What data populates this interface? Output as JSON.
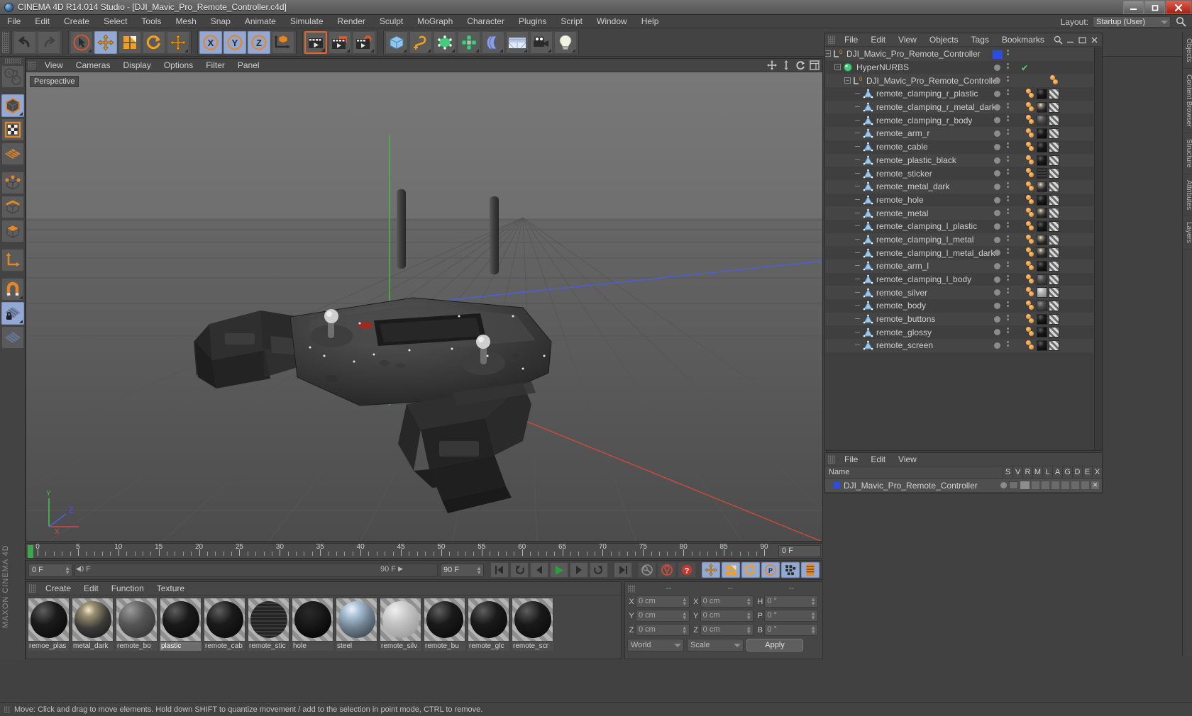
{
  "window": {
    "title": "CINEMA 4D R14.014 Studio - [DJI_Mavic_Pro_Remote_Controller.c4d]",
    "minimize": "—",
    "maximize": "❐",
    "close": "✕"
  },
  "menubar": {
    "items": [
      "File",
      "Edit",
      "Create",
      "Select",
      "Tools",
      "Mesh",
      "Snap",
      "Animate",
      "Simulate",
      "Render",
      "Sculpt",
      "MoGraph",
      "Character",
      "Plugins",
      "Script",
      "Window",
      "Help"
    ],
    "layout_label": "Layout:",
    "layout_value": "Startup (User)"
  },
  "toolbar": {
    "groups": [
      {
        "name": "history",
        "buttons": [
          {
            "name": "undo-button",
            "icon": "undo"
          },
          {
            "name": "redo-button",
            "icon": "redo"
          }
        ]
      },
      {
        "name": "transform",
        "buttons": [
          {
            "name": "live-selection-tool",
            "icon": "cursor",
            "state": "selected"
          },
          {
            "name": "move-tool",
            "icon": "move",
            "state": "on"
          },
          {
            "name": "scale-tool",
            "icon": "scale"
          },
          {
            "name": "rotate-tool",
            "icon": "rotate"
          },
          {
            "name": "move-axis-tool",
            "icon": "move2"
          }
        ]
      },
      {
        "name": "axis-locks",
        "buttons": [
          {
            "name": "lock-x-axis-button",
            "icon": "x",
            "state": "on"
          },
          {
            "name": "lock-y-axis-button",
            "icon": "y",
            "state": "on"
          },
          {
            "name": "lock-z-axis-button",
            "icon": "z",
            "state": "on"
          },
          {
            "name": "world-coordinates-button",
            "icon": "world"
          }
        ]
      },
      {
        "name": "render",
        "buttons": [
          {
            "name": "render-view-button",
            "icon": "clapper",
            "state": "selected"
          },
          {
            "name": "render-to-picture-viewer-button",
            "icon": "clapper-pic"
          },
          {
            "name": "render-settings-button",
            "icon": "clapper-gear"
          }
        ]
      },
      {
        "name": "objects",
        "buttons": [
          {
            "name": "add-cube-button",
            "icon": "cube"
          },
          {
            "name": "add-spline-button",
            "icon": "spline"
          },
          {
            "name": "add-generator-button",
            "icon": "nurbs"
          },
          {
            "name": "add-deformer-button",
            "icon": "array"
          },
          {
            "name": "add-bend-button",
            "icon": "bend"
          },
          {
            "name": "add-scene-button",
            "icon": "floor"
          },
          {
            "name": "add-camera-button",
            "icon": "camera"
          },
          {
            "name": "add-light-button",
            "icon": "light"
          }
        ]
      }
    ]
  },
  "left_palette": {
    "buttons": [
      {
        "name": "make-editable-button",
        "icon": "editable"
      },
      {
        "name": "model-mode-button",
        "icon": "model-cube",
        "state": "on"
      },
      {
        "name": "texture-mode-button",
        "icon": "texture"
      },
      {
        "name": "points-mode-button",
        "icon": "points-grid"
      },
      {
        "name": "point-mode-button",
        "icon": "point"
      },
      {
        "name": "edge-mode-button",
        "icon": "edge"
      },
      {
        "name": "polygon-mode-button",
        "icon": "polygon"
      },
      {
        "name": "axis-mode-button",
        "icon": "axis"
      },
      {
        "name": "enable-snap-button",
        "icon": "magnet"
      },
      {
        "name": "lock-workplane-button",
        "icon": "workplane-lock",
        "state": "on"
      },
      {
        "name": "workplane-button",
        "icon": "workplane"
      }
    ],
    "branding": "MAXON CINEMA 4D"
  },
  "viewport": {
    "menu": [
      "View",
      "Cameras",
      "Display",
      "Options",
      "Filter",
      "Panel"
    ],
    "label": "Perspective",
    "icons": [
      "move-view-icon",
      "scale-view-icon",
      "rotate-view-icon",
      "maximize-view-icon"
    ],
    "axis_labels": {
      "x": "X",
      "y": "Y",
      "z": "Z"
    }
  },
  "timeline": {
    "ticks": [
      0,
      5,
      10,
      15,
      20,
      25,
      30,
      35,
      40,
      45,
      50,
      55,
      60,
      65,
      70,
      75,
      80,
      85,
      90
    ],
    "current_frame_field": "0 F"
  },
  "transport": {
    "start_field": "0 F",
    "current_field": "0 F",
    "end_field": "90 F",
    "range_field": "90 F",
    "buttons": [
      {
        "name": "go-to-start-button",
        "icon": "skip-start"
      },
      {
        "name": "play-backwards-button",
        "icon": "loop-back"
      },
      {
        "name": "step-back-button",
        "icon": "prev-frame"
      },
      {
        "name": "play-button",
        "icon": "play"
      },
      {
        "name": "step-forward-button",
        "icon": "next-frame"
      },
      {
        "name": "play-forward-loop-button",
        "icon": "loop-fwd"
      },
      {
        "name": "go-to-end-button",
        "icon": "skip-end"
      },
      {
        "name": "record-active-objects-button",
        "icon": "key"
      },
      {
        "name": "autokeying-button",
        "icon": "auto-key"
      },
      {
        "name": "keyframe-selection-button",
        "icon": "question"
      },
      {
        "name": "position-key-button",
        "icon": "move",
        "state": "on"
      },
      {
        "name": "scale-key-button",
        "icon": "scale",
        "state": "on"
      },
      {
        "name": "rotation-key-button",
        "icon": "rotate",
        "state": "on"
      },
      {
        "name": "parameter-key-button",
        "icon": "param",
        "state": "on"
      },
      {
        "name": "pla-key-button",
        "icon": "pla",
        "state": "on"
      },
      {
        "name": "timeline-toggle-button",
        "icon": "timeline",
        "state": "on"
      }
    ]
  },
  "material_manager": {
    "menu": [
      "Create",
      "Edit",
      "Function",
      "Texture"
    ],
    "materials": [
      {
        "name": "remoe_plastic",
        "label": "remoe_plas",
        "preview": "black-gloss"
      },
      {
        "name": "metal_dark",
        "label": "metal_dark",
        "preview": "chrome"
      },
      {
        "name": "remote_body",
        "label": "remote_bo",
        "preview": "gray-matte"
      },
      {
        "name": "plastic",
        "label": "plastic",
        "preview": "black-gloss",
        "selected": true
      },
      {
        "name": "remote_cable",
        "label": "remote_cab",
        "preview": "black-gloss"
      },
      {
        "name": "remote_sticker",
        "label": "remote_stic",
        "preview": "sticker"
      },
      {
        "name": "hole",
        "label": "hole",
        "preview": "flat-black"
      },
      {
        "name": "steel",
        "label": "steel",
        "preview": "chrome-env"
      },
      {
        "name": "remote_silver",
        "label": "remote_silv",
        "preview": "silver"
      },
      {
        "name": "remote_buttons",
        "label": "remote_bu",
        "preview": "black-gloss"
      },
      {
        "name": "remote_glossy",
        "label": "remote_glc",
        "preview": "black-gloss"
      },
      {
        "name": "remote_screen",
        "label": "remote_scr",
        "preview": "black-gloss"
      }
    ]
  },
  "coordinates": {
    "header": [
      "--",
      "--",
      "--"
    ],
    "rows": [
      {
        "label1": "X",
        "value1": "0 cm",
        "label2": "X",
        "value2": "0 cm",
        "label3": "H",
        "value3": "0 °"
      },
      {
        "label1": "Y",
        "value1": "0 cm",
        "label2": "Y",
        "value2": "0 cm",
        "label3": "P",
        "value3": "0 °"
      },
      {
        "label1": "Z",
        "value1": "0 cm",
        "label2": "Z",
        "value2": "0 cm",
        "label3": "B",
        "value3": "0 °"
      }
    ],
    "system": "World",
    "mode": "Scale",
    "apply": "Apply"
  },
  "object_manager": {
    "menu": [
      "File",
      "Edit",
      "View",
      "Objects",
      "Tags",
      "Bookmarks"
    ],
    "rows": [
      {
        "label": "DJI_Mavic_Pro_Remote_Controller",
        "icon": "null-object-icon",
        "depth": 0,
        "expander": true,
        "visbox": "blue",
        "tags": []
      },
      {
        "label": "HyperNURBS",
        "icon": "hypernurbs-icon",
        "depth": 1,
        "expander": true,
        "check": true,
        "tags": []
      },
      {
        "label": "DJI_Mavic_Pro_Remote_Controller",
        "icon": "null-object-icon",
        "depth": 2,
        "expander": true,
        "tags": [
          "dots"
        ]
      },
      {
        "label": "remote_clamping_r_plastic",
        "icon": "polygon-object-icon",
        "depth": 3,
        "tags": [
          "dots",
          "mat",
          "chk"
        ]
      },
      {
        "label": "remote_clamping_r_metal_dark",
        "icon": "polygon-object-icon",
        "depth": 3,
        "tags": [
          "dots",
          "mat2",
          "chk"
        ]
      },
      {
        "label": "remote_clamping_r_body",
        "icon": "polygon-object-icon",
        "depth": 3,
        "tags": [
          "dots",
          "mat3",
          "chk"
        ]
      },
      {
        "label": "remote_arm_r",
        "icon": "polygon-object-icon",
        "depth": 3,
        "tags": [
          "dots",
          "mat",
          "chk"
        ]
      },
      {
        "label": "remote_cable",
        "icon": "polygon-object-icon",
        "depth": 3,
        "tags": [
          "dots",
          "mat",
          "chk"
        ]
      },
      {
        "label": "remote_plastic_black",
        "icon": "polygon-object-icon",
        "depth": 3,
        "tags": [
          "dots",
          "mat",
          "chk"
        ]
      },
      {
        "label": "remote_sticker",
        "icon": "polygon-object-icon",
        "depth": 3,
        "tags": [
          "dots",
          "mat4",
          "chk"
        ]
      },
      {
        "label": "remote_metal_dark",
        "icon": "polygon-object-icon",
        "depth": 3,
        "tags": [
          "dots",
          "mat2",
          "chk"
        ]
      },
      {
        "label": "remote_hole",
        "icon": "polygon-object-icon",
        "depth": 3,
        "tags": [
          "dots",
          "mat",
          "chk"
        ]
      },
      {
        "label": "remote_metal",
        "icon": "polygon-object-icon",
        "depth": 3,
        "tags": [
          "dots",
          "mat2",
          "chk"
        ]
      },
      {
        "label": "remote_clamping_l_plastic",
        "icon": "polygon-object-icon",
        "depth": 3,
        "tags": [
          "dots",
          "mat",
          "chk"
        ]
      },
      {
        "label": "remote_clamping_l_metal",
        "icon": "polygon-object-icon",
        "depth": 3,
        "tags": [
          "dots",
          "mat2",
          "chk"
        ]
      },
      {
        "label": "remote_clamping_l_metal_dark",
        "icon": "polygon-object-icon",
        "depth": 3,
        "tags": [
          "dots",
          "mat2",
          "chk"
        ]
      },
      {
        "label": "remote_arm_l",
        "icon": "polygon-object-icon",
        "depth": 3,
        "tags": [
          "dots",
          "mat",
          "chk"
        ]
      },
      {
        "label": "remote_clamping_l_body",
        "icon": "polygon-object-icon",
        "depth": 3,
        "tags": [
          "dots",
          "mat3",
          "chk"
        ]
      },
      {
        "label": "remote_silver",
        "icon": "polygon-object-icon",
        "depth": 3,
        "tags": [
          "dots",
          "mat5",
          "chk"
        ]
      },
      {
        "label": "remote_body",
        "icon": "polygon-object-icon",
        "depth": 3,
        "tags": [
          "dots",
          "mat3",
          "chk"
        ]
      },
      {
        "label": "remote_buttons",
        "icon": "polygon-object-icon",
        "depth": 3,
        "tags": [
          "dots",
          "mat",
          "chk"
        ]
      },
      {
        "label": "remote_glossy",
        "icon": "polygon-object-icon",
        "depth": 3,
        "tags": [
          "dots",
          "mat",
          "chk"
        ]
      },
      {
        "label": "remote_screen",
        "icon": "polygon-object-icon",
        "depth": 3,
        "tags": [
          "dots",
          "mat",
          "chk"
        ]
      }
    ]
  },
  "attribute_manager": {
    "menu": [
      "File",
      "Edit",
      "View"
    ],
    "columns": [
      "Name",
      "S",
      "V",
      "R",
      "M",
      "L",
      "A",
      "G",
      "D",
      "E",
      "X"
    ],
    "row_label": "DJI_Mavic_Pro_Remote_Controller"
  },
  "right_dock": {
    "tabs": [
      "Objects",
      "Content Browser",
      "Structure",
      "Attributes",
      "Layers"
    ]
  },
  "status": {
    "message": "Move: Click and drag to move elements. Hold down SHIFT to quantize movement / add to the selection in point mode, CTRL to remove."
  },
  "colors": {
    "accent_orange": "#e2862a",
    "blue_active": "#93a9d4",
    "selection_blue": "#2c4ee0",
    "green": "#3ba94b",
    "red": "#cc3a33"
  }
}
